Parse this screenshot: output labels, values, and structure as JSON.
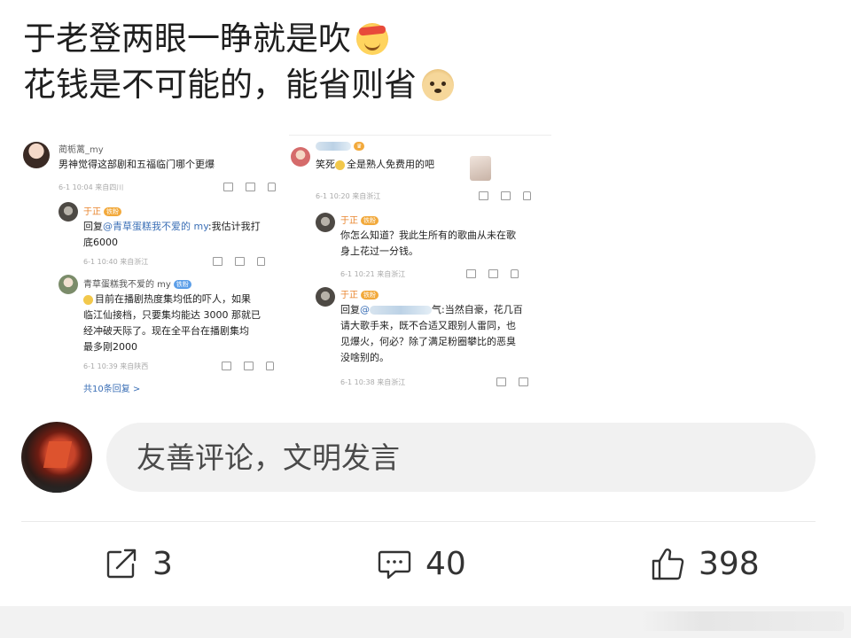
{
  "post": {
    "line1": "于老登两眼一睁就是吹",
    "line1_emoji": "bandage-grin-emoji",
    "line2": "花钱是不可能的，能省则省",
    "line2_emoji": "doge-emoji"
  },
  "screenshot_left": {
    "comment": {
      "user": "蔺栀蓠_my",
      "text": "男神觉得这部剧和五福临门哪个更爆",
      "meta": "6-1 10:04 来自四川"
    },
    "reply1": {
      "user": "于正",
      "badge": "铁粉",
      "text_prefix": "回复",
      "mention": "@青草蛋糕我不爱的 my",
      "text_line1": ":我估计我打",
      "text_line2": "底6000",
      "meta": "6-1 10:40 来自浙江"
    },
    "reply2": {
      "user": "青草蛋糕我不爱的 my",
      "badge": "铁粉",
      "line1": "目前在播剧热度集均低的吓人，如果",
      "line2": "临江仙接档，只要集均能达 3000 那就已",
      "line3": "经冲破天际了。现在全平台在播剧集均",
      "line4": "最多刚2000",
      "meta": "6-1 10:39 来自陕西"
    },
    "more_replies": "共10条回复 >"
  },
  "screenshot_right": {
    "comment": {
      "text_prefix": "笑死",
      "text": "全是熟人免费用的吧",
      "meta": "6-1 10:20 来自浙江"
    },
    "reply1": {
      "user": "于正",
      "badge": "铁粉",
      "line1": "你怎么知道？我此生所有的歌曲从未在歌",
      "line2": "身上花过一分钱。",
      "meta": "6-1 10:21 来自浙江"
    },
    "reply2": {
      "user": "于正",
      "badge": "铁粉",
      "text_prefix": "回复",
      "line1_suffix": "气:当然自豪，花几百",
      "line2": "请大歌手来，既不合适又跟别人雷同，也",
      "line3": "见爆火，何必？除了满足粉圈攀比的恶臭",
      "line4": "没啥别的。",
      "meta": "6-1 10:38 来自浙江"
    }
  },
  "composer": {
    "placeholder": "友善评论，文明发言"
  },
  "actions": {
    "share_count": "3",
    "comment_count": "40",
    "like_count": "398"
  }
}
